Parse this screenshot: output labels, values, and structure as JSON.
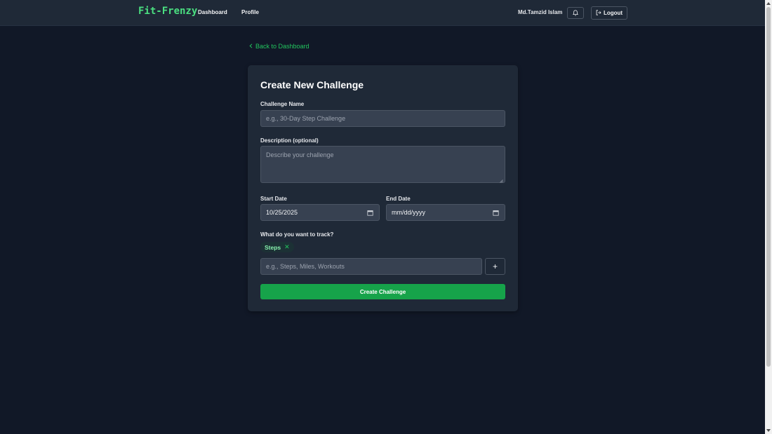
{
  "nav": {
    "brand": "Fit-Frenzy",
    "dashboard": "Dashboard",
    "profile": "Profile",
    "user_name": "Md.Tamzid Islam",
    "bell_icon": "bell-icon",
    "logout": "Logout",
    "logout_icon": "logout-icon"
  },
  "back_link": {
    "label": "Back to Dashboard",
    "icon": "chevron-left-icon"
  },
  "form": {
    "title": "Create New Challenge",
    "name_label": "Challenge Name",
    "name_placeholder": "e.g., 30-Day Step Challenge",
    "description_label": "Description (optional)",
    "description_placeholder": "Describe your challenge",
    "start_label": "Start Date",
    "start_value": "10/25/2025",
    "end_label": "End Date",
    "end_value": "mm/dd/yyyy",
    "track_label": "What do you want to track?",
    "tags": [
      "Steps"
    ],
    "track_placeholder": "e.g., Steps, Miles, Workouts",
    "add_button": "+",
    "submit": "Create Challenge"
  },
  "colors": {
    "accent": "#22c55e",
    "background": "#111827",
    "card": "#1f2937",
    "input": "#374151",
    "button": "#16a34a"
  }
}
